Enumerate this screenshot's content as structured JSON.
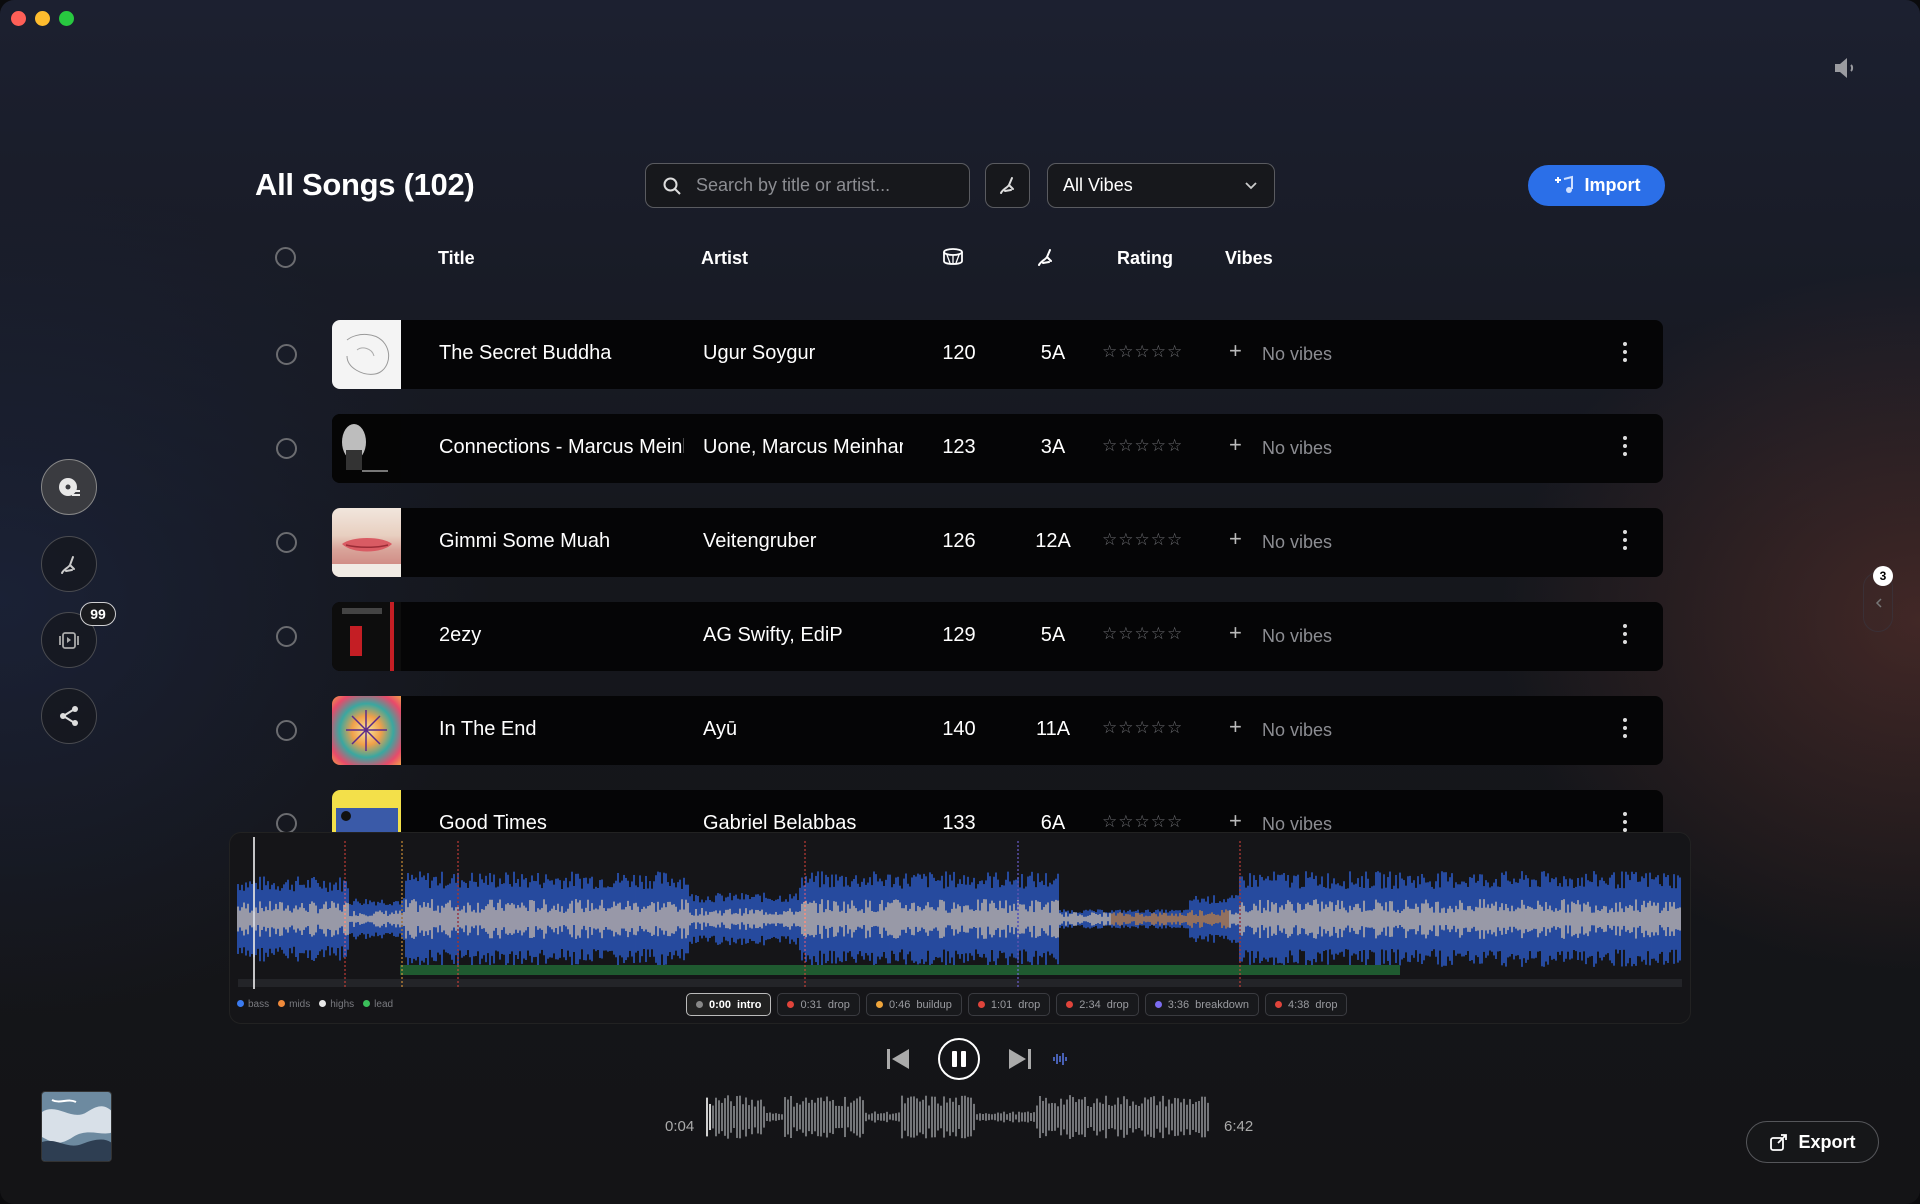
{
  "header": {
    "title": "All Songs (102)"
  },
  "search": {
    "placeholder": "Search by title or artist..."
  },
  "filters": {
    "vibes_selected": "All Vibes"
  },
  "toolbar": {
    "import_label": "Import",
    "export_label": "Export"
  },
  "columns": {
    "title": "Title",
    "artist": "Artist",
    "bpm_icon": "drum-icon",
    "key_icon": "trumpet-icon",
    "rating": "Rating",
    "vibes": "Vibes"
  },
  "songs": [
    {
      "title": "The Secret Buddha",
      "artist": "Ugur Soygur",
      "bpm": "120",
      "key": "5A",
      "rating": "☆☆☆☆☆",
      "vibes": "No vibes"
    },
    {
      "title": "Connections - Marcus Meinhardt Remix",
      "artist": "Uone, Marcus Meinhardt",
      "bpm": "123",
      "key": "3A",
      "rating": "☆☆☆☆☆",
      "vibes": "No vibes"
    },
    {
      "title": "Gimmi Some Muah",
      "artist": "Veitengruber",
      "bpm": "126",
      "key": "12A",
      "rating": "☆☆☆☆☆",
      "vibes": "No vibes"
    },
    {
      "title": "2ezy",
      "artist": "AG Swifty, EdiP",
      "bpm": "129",
      "key": "5A",
      "rating": "☆☆☆☆☆",
      "vibes": "No vibes"
    },
    {
      "title": "In The End",
      "artist": "Ayū",
      "bpm": "140",
      "key": "11A",
      "rating": "☆☆☆☆☆",
      "vibes": "No vibes"
    },
    {
      "title": "Good Times",
      "artist": "Gabriel Belabbas",
      "bpm": "133",
      "key": "6A",
      "rating": "☆☆☆☆☆",
      "vibes": "No vibes"
    }
  ],
  "sidebar": {
    "badge_count": "99"
  },
  "right_panel": {
    "badge_count": "3"
  },
  "waveform": {
    "legend": [
      {
        "label": "bass",
        "color": "#3b7bf0"
      },
      {
        "label": "mids",
        "color": "#f08a3b"
      },
      {
        "label": "highs",
        "color": "#e8e8e8"
      },
      {
        "label": "lead",
        "color": "#3bbf5a"
      }
    ],
    "cues": [
      {
        "time": "0:00",
        "label": "intro",
        "color": "#888888"
      },
      {
        "time": "0:31",
        "label": "drop",
        "color": "#e0443b"
      },
      {
        "time": "0:46",
        "label": "buildup",
        "color": "#f0a53b"
      },
      {
        "time": "1:01",
        "label": "drop",
        "color": "#e0443b"
      },
      {
        "time": "2:34",
        "label": "drop",
        "color": "#e0443b"
      },
      {
        "time": "3:36",
        "label": "breakdown",
        "color": "#7b6cf0"
      },
      {
        "time": "4:38",
        "label": "drop",
        "color": "#e0443b"
      }
    ]
  },
  "player": {
    "elapsed": "0:04",
    "duration": "6:42"
  }
}
